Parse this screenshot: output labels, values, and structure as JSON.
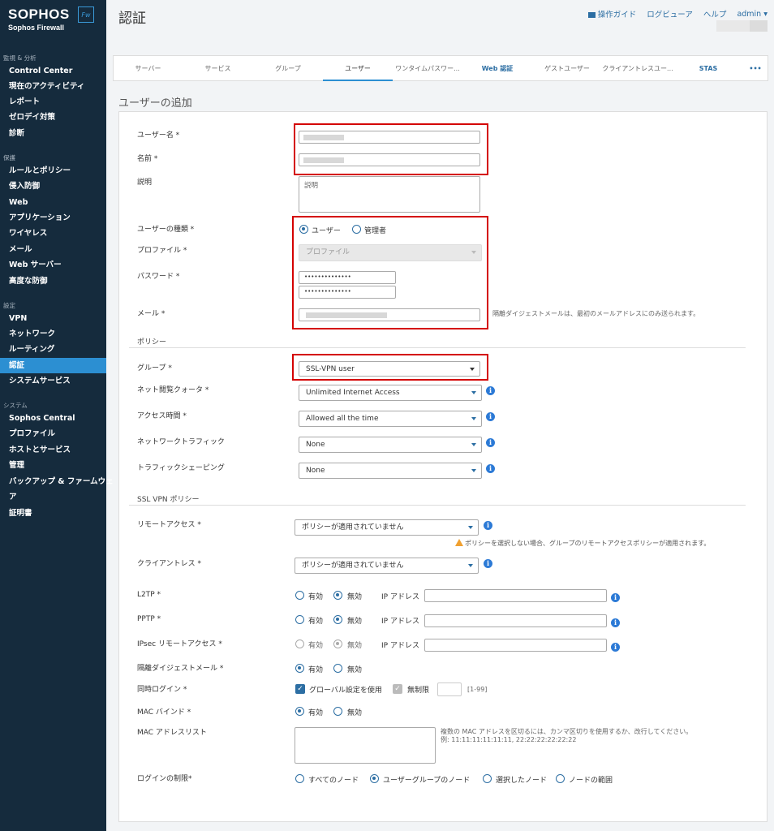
{
  "brand": {
    "logo": "SOPHOS",
    "product": "Sophos Firewall",
    "badge": "Fw"
  },
  "sidebar": {
    "sections": [
      {
        "title": "監視 & 分析",
        "items": [
          "Control Center",
          "現在のアクティビティ",
          "レポート",
          "ゼロデイ対策",
          "診断"
        ]
      },
      {
        "title": "保護",
        "items": [
          "ルールとポリシー",
          "侵入防御",
          "Web",
          "アプリケーション",
          "ワイヤレス",
          "メール",
          "Web サーバー",
          "高度な防御"
        ]
      },
      {
        "title": "設定",
        "items": [
          "VPN",
          "ネットワーク",
          "ルーティング",
          "認証",
          "システムサービス"
        ]
      },
      {
        "title": "システム",
        "items": [
          "Sophos Central",
          "プロファイル",
          "ホストとサービス",
          "管理",
          "バックアップ & ファームウェ",
          "ア",
          "証明書"
        ]
      }
    ],
    "active": "認証"
  },
  "header": {
    "title": "認証",
    "guide": "操作ガイド",
    "log_viewer": "ログビューア",
    "help": "ヘルプ",
    "admin": "admin ▾"
  },
  "tabs": [
    "サーバー",
    "サービス",
    "グループ",
    "ユーザー",
    "ワンタイムパスワー...",
    "Web 認証",
    "ゲストユーザー",
    "クライアントレスユー...",
    "STAS",
    "•••"
  ],
  "form": {
    "heading": "ユーザーの追加",
    "username_label": "ユーザー名 *",
    "name_label": "名前 *",
    "description_label": "説明",
    "description_placeholder": "説明",
    "user_type_label": "ユーザーの種類 *",
    "user_type_options": [
      "ユーザー",
      "管理者"
    ],
    "profile_label": "プロファイル *",
    "profile_placeholder": "プロファイル",
    "password_label": "パスワード *",
    "password_mask": "••••••••••••••",
    "email_label": "メール *",
    "email_note": "隔離ダイジェストメールは、最初のメールアドレスにのみ送られます。",
    "policy_heading": "ポリシー",
    "group_label": "グループ *",
    "group_value": "SSL-VPN user",
    "quota_label": "ネット閲覧クォータ *",
    "quota_value": "Unlimited Internet Access",
    "access_time_label": "アクセス時間 *",
    "access_time_value": "Allowed all the time",
    "traffic_label": "ネットワークトラフィック",
    "traffic_value": "None",
    "shaping_label": "トラフィックシェーピング",
    "shaping_value": "None",
    "sslvpn_heading": "SSL VPN ポリシー",
    "remote_access_label": "リモートアクセス *",
    "remote_access_value": "ポリシーが適用されていません",
    "remote_access_warning": "ポリシーを選択しない場合、グループのリモートアクセスポリシーが適用されます。",
    "clientless_label": "クライアントレス *",
    "clientless_value": "ポリシーが適用されていません",
    "l2tp_label": "L2TP *",
    "pptp_label": "PPTP *",
    "ipsec_label": "IPsec リモートアクセス *",
    "enabled": "有効",
    "disabled": "無効",
    "ip_label": "IP アドレス",
    "quarantine_label": "隔離ダイジェストメール *",
    "concurrent_label": "同時ログイン *",
    "use_global": "グローバル設定を使用",
    "unlimited": "無制限",
    "range": "[1-99]",
    "mac_bind_label": "MAC バインド *",
    "mac_list_label": "MAC アドレスリスト",
    "mac_note1": "複数の MAC アドレスを区切るには、カンマ区切りを使用するか、改行してください。",
    "mac_note2": "例: 11:11:11:11:11:11, 22:22:22:22:22:22",
    "login_restrict_label": "ログインの制限*",
    "login_options": [
      "すべてのノード",
      "ユーザーグループのノード",
      "選択したノード",
      "ノードの範囲"
    ]
  }
}
